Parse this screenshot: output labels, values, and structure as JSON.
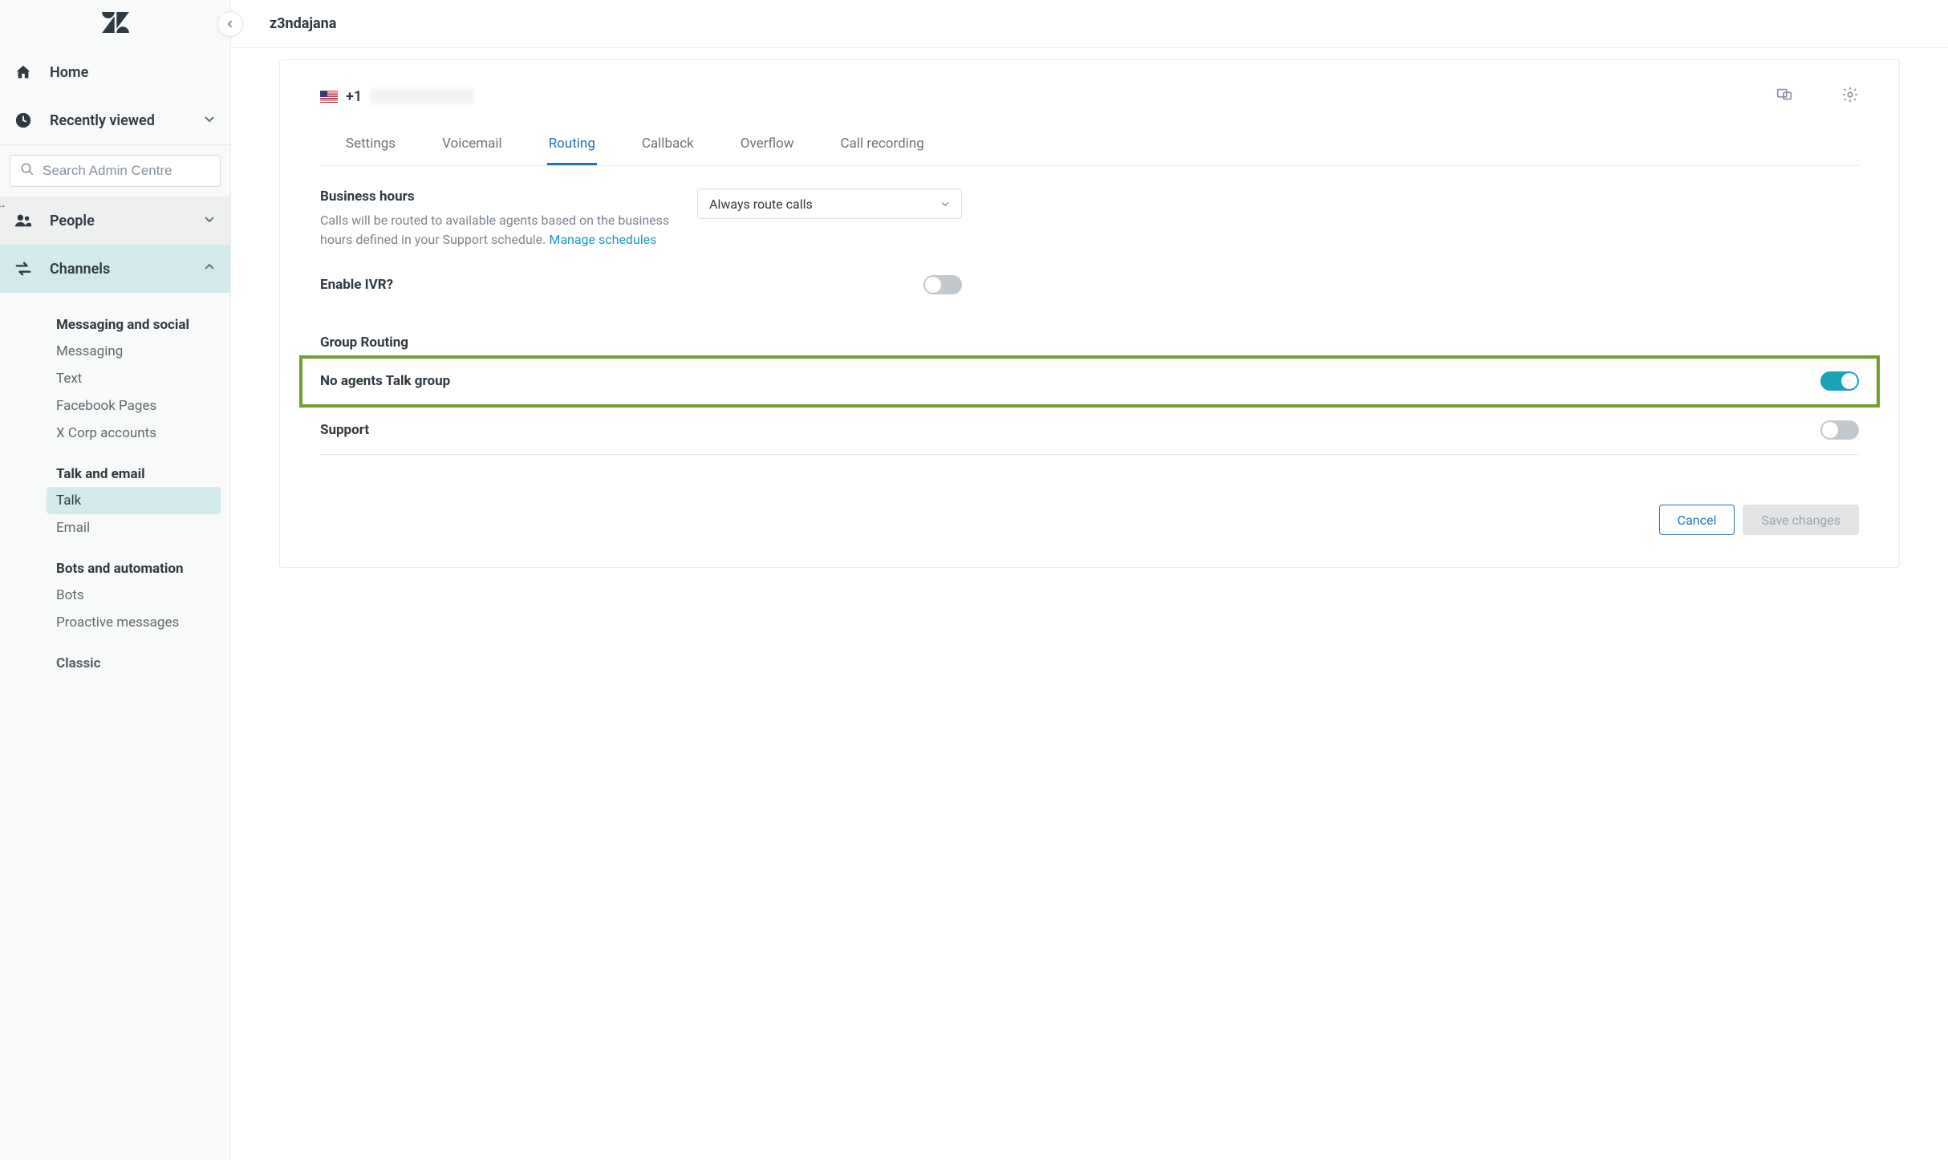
{
  "workspace": "z3ndajana",
  "sidebar": {
    "home": "Home",
    "recently_viewed": "Recently viewed",
    "search_placeholder": "Search Admin Centre",
    "people": "People",
    "channels": "Channels",
    "groups": {
      "messaging": {
        "title": "Messaging and social",
        "items": [
          "Messaging",
          "Text",
          "Facebook Pages",
          "X Corp accounts"
        ]
      },
      "talk_email": {
        "title": "Talk and email",
        "items": [
          "Talk",
          "Email"
        ],
        "active_index": 0
      },
      "bots": {
        "title": "Bots and automation",
        "items": [
          "Bots",
          "Proactive messages"
        ]
      },
      "classic": {
        "title": "Classic"
      }
    }
  },
  "phone": {
    "prefix": "+1"
  },
  "tabs": [
    "Settings",
    "Voicemail",
    "Routing",
    "Callback",
    "Overflow",
    "Call recording"
  ],
  "tabs_active_index": 2,
  "business_hours": {
    "title": "Business hours",
    "desc_prefix": "Calls will be routed to available agents based on the business hours defined in your Support schedule. ",
    "link": "Manage schedules",
    "select_value": "Always route calls"
  },
  "ivr": {
    "title": "Enable IVR?",
    "enabled": false
  },
  "group_routing": {
    "heading": "Group Routing",
    "rows": [
      {
        "label": "No agents Talk group",
        "enabled": true,
        "highlight": true
      },
      {
        "label": "Support",
        "enabled": false,
        "highlight": false
      }
    ]
  },
  "footer": {
    "cancel": "Cancel",
    "save": "Save changes"
  }
}
